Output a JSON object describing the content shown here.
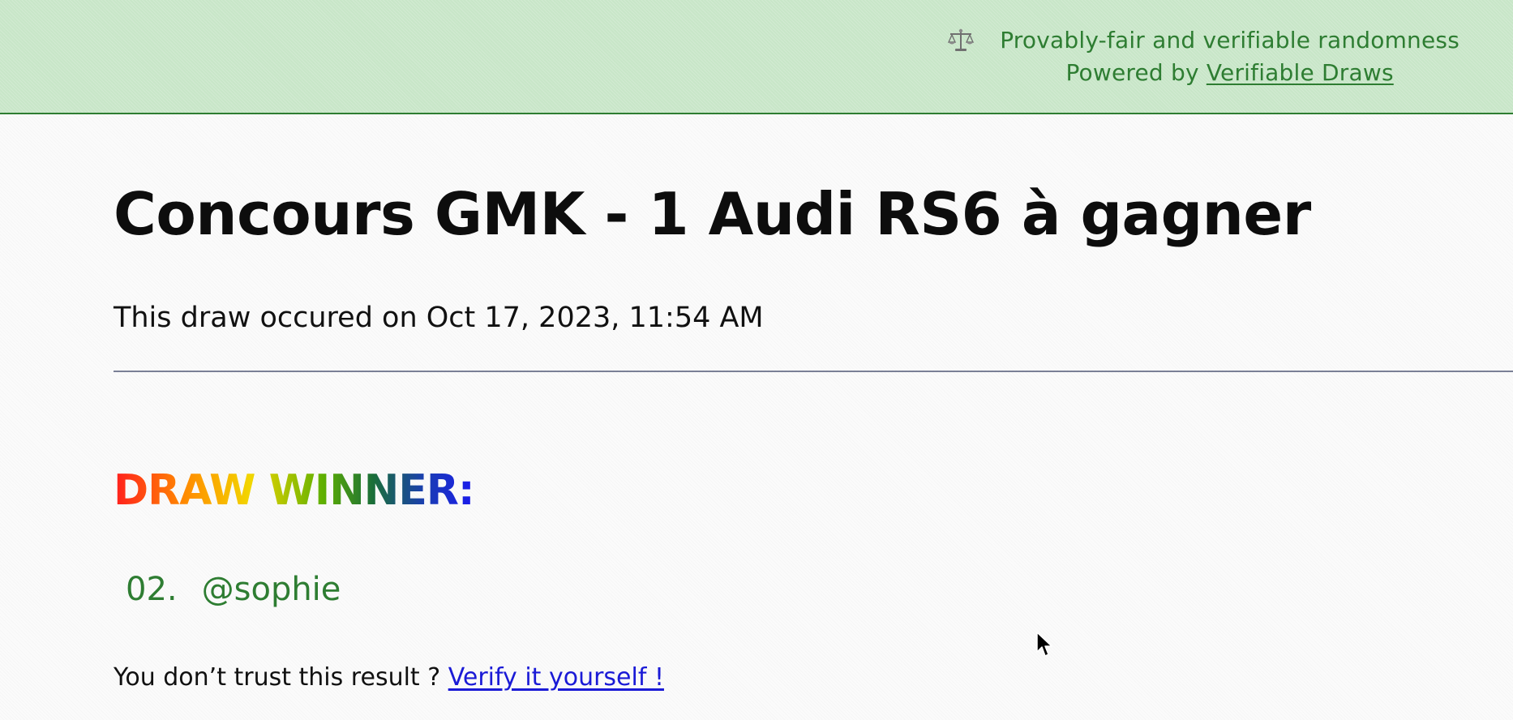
{
  "topbar": {
    "icon": "scales-icon",
    "tagline": "Provably-fair and verifiable randomness",
    "powered_by_prefix": "Powered by ",
    "powered_by_link": "Verifiable Draws"
  },
  "main": {
    "title": "Concours GMK - 1 Audi RS6 à gagner",
    "draw_date": "This draw occured on Oct 17, 2023, 11:54 AM",
    "winner_heading": "DRAW WINNER:",
    "winners": [
      {
        "index": "02.",
        "handle": "@sophie"
      }
    ],
    "verify_prefix": "You don’t trust this result ? ",
    "verify_link": "Verify it yourself !"
  },
  "colors": {
    "header_bg": "#c8e6c8",
    "accent_green": "#2e7d32",
    "link_blue": "#1a1ad6"
  }
}
